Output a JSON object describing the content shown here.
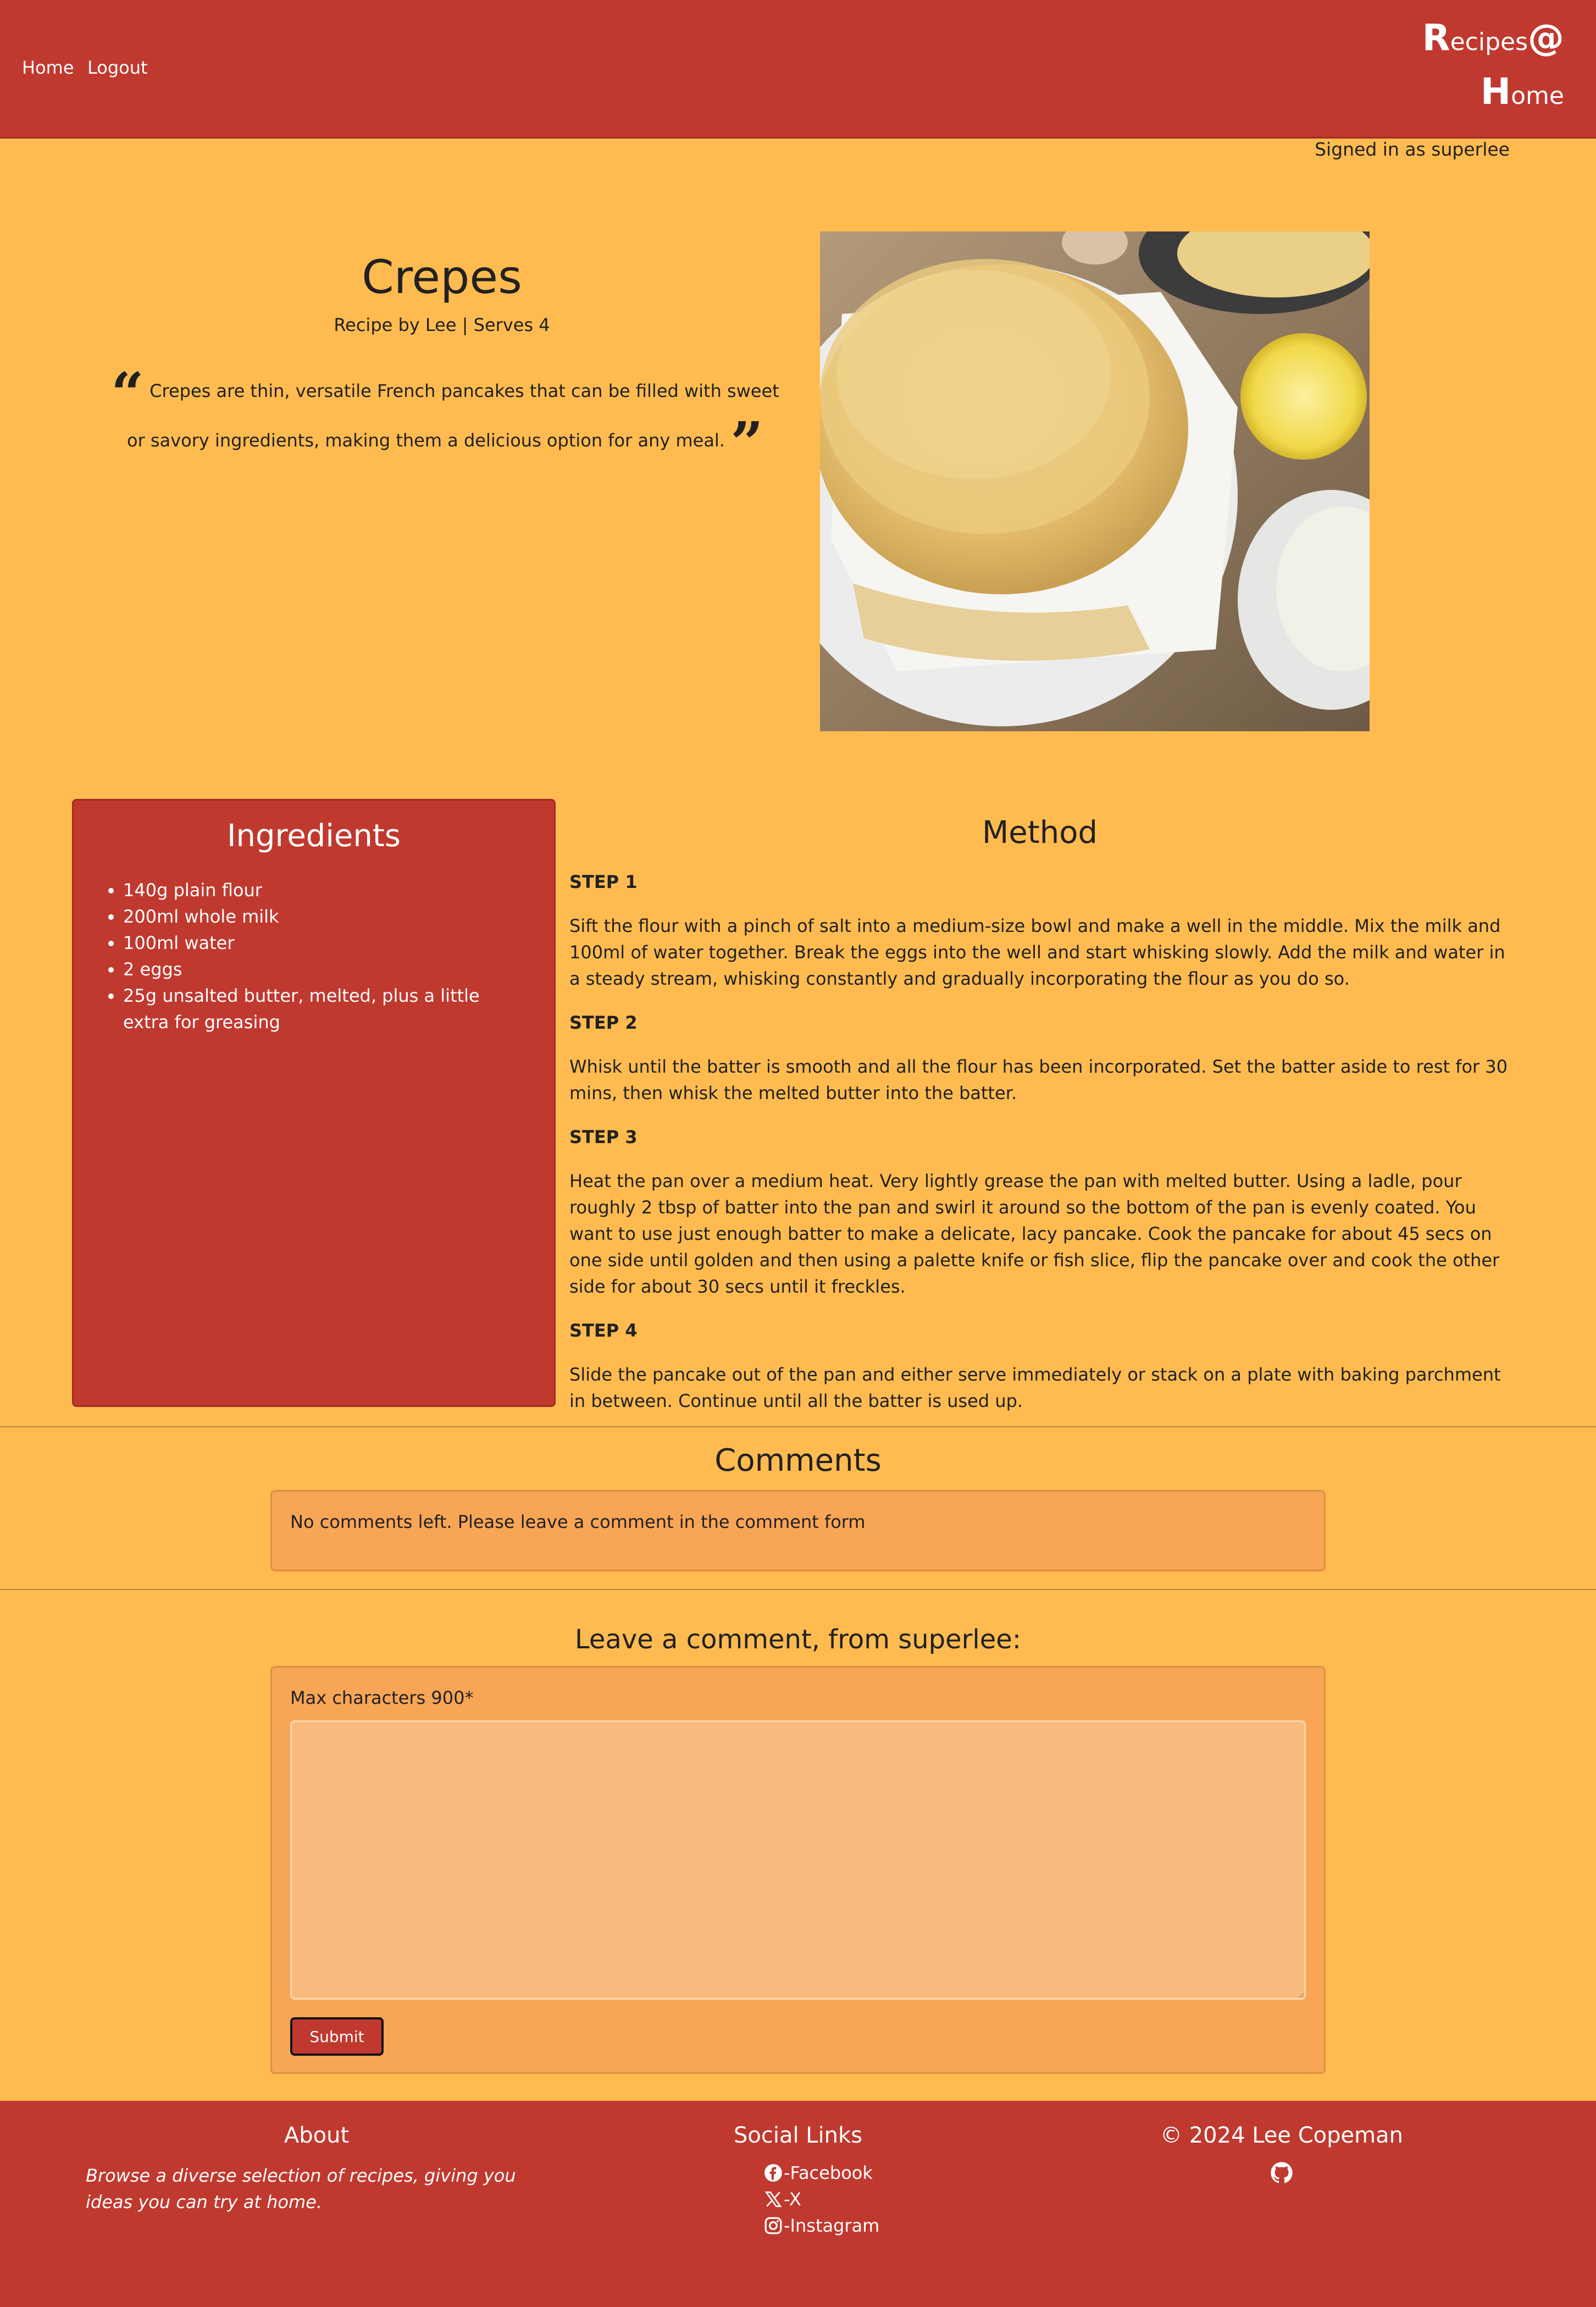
{
  "nav": {
    "home": "Home",
    "logout": "Logout"
  },
  "brand": {
    "r": "R",
    "ecipes": "ecipes",
    "at": "@",
    "h": "H",
    "ome": "ome"
  },
  "user": {
    "signed_in": "Signed in as superlee"
  },
  "recipe": {
    "title": "Crepes",
    "meta": "Recipe by Lee | Serves 4",
    "description": "Crepes are thin, versatile French pancakes that can be filled with sweet or savory ingredients, making them a delicious option for any meal.",
    "quote_open": "“",
    "quote_close": "”"
  },
  "ingredients": {
    "title": "Ingredients",
    "items": [
      "140g plain flour",
      "200ml whole milk",
      "100ml water",
      "2 eggs",
      "25g unsalted butter, melted, plus a little extra for greasing"
    ]
  },
  "method": {
    "title": "Method",
    "steps": [
      {
        "heading": "STEP 1",
        "text": "Sift the flour with a pinch of salt into a medium-size bowl and make a well in the middle. Mix the milk and 100ml of water together. Break the eggs into the well and start whisking slowly. Add the milk and water in a steady stream, whisking constantly and gradually incorporating the flour as you do so."
      },
      {
        "heading": "STEP 2",
        "text": "Whisk until the batter is smooth and all the flour has been incorporated. Set the batter aside to rest for 30 mins, then whisk the melted butter into the batter."
      },
      {
        "heading": "STEP 3",
        "text": "Heat the pan over a medium heat. Very lightly grease the pan with melted butter. Using a ladle, pour roughly 2 tbsp of batter into the pan and swirl it around so the bottom of the pan is evenly coated. You want to use just enough batter to make a delicate, lacy pancake. Cook the pancake for about 45 secs on one side until golden and then using a palette knife or fish slice, flip the pancake over and cook the other side for about 30 secs until it freckles."
      },
      {
        "heading": "STEP 4",
        "text": "Slide the pancake out of the pan and either serve immediately or stack on a plate with baking parchment in between. Continue until all the batter is used up."
      }
    ]
  },
  "comments": {
    "title": "Comments",
    "empty": "No comments left. Please leave a comment in the comment form"
  },
  "comment_form": {
    "title": "Leave a comment, from superlee:",
    "label": "Max characters 900*",
    "value": "",
    "submit": "Submit"
  },
  "footer": {
    "about_title": "About",
    "about_text": "Browse a diverse selection of recipes, giving you ideas you can try at home.",
    "social_title": "Social Links",
    "social": [
      {
        "icon": "facebook-icon",
        "label": "-Facebook"
      },
      {
        "icon": "x-icon",
        "label": "-X"
      },
      {
        "icon": "instagram-icon",
        "label": "-Instagram"
      }
    ],
    "copyright": "© 2024 Lee Copeman",
    "github_icon": "github-icon"
  },
  "colors": {
    "primary": "#c0392f",
    "background": "#ffbb50",
    "card": "#f8a556"
  }
}
